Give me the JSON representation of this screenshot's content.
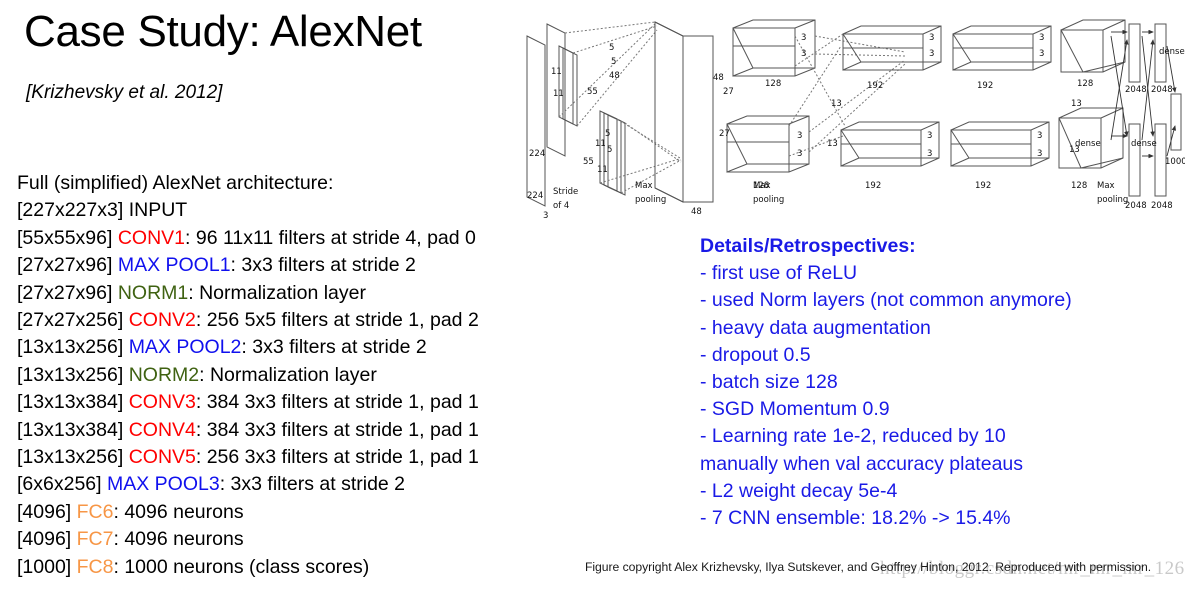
{
  "slide": {
    "title": "Case Study: AlexNet",
    "citation": "[Krizhevsky et al. 2012]"
  },
  "architecture": {
    "heading": "Full (simplified) AlexNet architecture:",
    "lines": [
      {
        "dims": "[227x227x3]",
        "layer": "INPUT",
        "layer_color": "plain",
        "desc": ""
      },
      {
        "dims": "[55x55x96]",
        "layer": "CONV1",
        "layer_color": "conv",
        "desc": ": 96 11x11 filters at stride 4, pad 0"
      },
      {
        "dims": "[27x27x96]",
        "layer": "MAX POOL1",
        "layer_color": "pool",
        "desc": ": 3x3 filters at stride 2"
      },
      {
        "dims": "[27x27x96]",
        "layer": "NORM1",
        "layer_color": "norm",
        "desc": ": Normalization layer"
      },
      {
        "dims": "[27x27x256]",
        "layer": "CONV2",
        "layer_color": "conv",
        "desc": ": 256 5x5 filters at stride 1, pad 2"
      },
      {
        "dims": "[13x13x256]",
        "layer": "MAX POOL2",
        "layer_color": "pool",
        "desc": ": 3x3 filters at stride 2"
      },
      {
        "dims": "[13x13x256]",
        "layer": "NORM2",
        "layer_color": "norm",
        "desc": ": Normalization layer"
      },
      {
        "dims": "[13x13x384]",
        "layer": "CONV3",
        "layer_color": "conv",
        "desc": ": 384 3x3 filters at stride 1, pad 1"
      },
      {
        "dims": "[13x13x384]",
        "layer": "CONV4",
        "layer_color": "conv",
        "desc": ": 384 3x3 filters at stride 1, pad 1"
      },
      {
        "dims": "[13x13x256]",
        "layer": "CONV5",
        "layer_color": "conv",
        "desc": ": 256 3x3 filters at stride 1, pad 1"
      },
      {
        "dims": "[6x6x256]",
        "layer": "MAX POOL3",
        "layer_color": "pool",
        "desc": ": 3x3 filters at stride 2"
      },
      {
        "dims": "[4096]",
        "layer": "FC6",
        "layer_color": "fc",
        "desc": ": 4096 neurons"
      },
      {
        "dims": "[4096]",
        "layer": "FC7",
        "layer_color": "fc",
        "desc": ": 4096 neurons"
      },
      {
        "dims": "[1000]",
        "layer": "FC8",
        "layer_color": "fc",
        "desc": ": 1000 neurons (class scores)"
      }
    ]
  },
  "details": {
    "heading": "Details/Retrospectives:",
    "bullets": [
      "- first use of ReLU",
      "- used Norm layers (not common anymore)",
      "- heavy data augmentation",
      "- dropout 0.5",
      "- batch size 128",
      "- SGD Momentum 0.9",
      "- Learning rate 1e-2, reduced by 10",
      "manually when val accuracy plateaus",
      "- L2 weight decay 5e-4",
      "- 7 CNN ensemble: 18.2% -> 15.4%"
    ]
  },
  "figure": {
    "caption": "Figure copyright Alex Krizhevsky, Ilya Sutskever, and Geoffrey Hinton, 2012. Reproduced with permission.",
    "watermark": "http://bloggr.csdn.net/mr_mr_mr_126",
    "labels": {
      "input_h": "224",
      "input_w": "224",
      "input_depth": "3",
      "filter11_a": "11",
      "filter11_b": "11",
      "filter11_c": "11",
      "filter11_d": "11",
      "stride_of_4": "Stride\nof 4",
      "stride_line1": "Stride",
      "stride_line2": "of 4",
      "conv1_size_top": "55",
      "conv1_size_bottom": "55",
      "conv1_depth_top": "48",
      "conv1_depth_bottom": "48",
      "k5_a": "5",
      "k5_b": "5",
      "k5_c": "5",
      "k5_d": "5",
      "conv2_size_top": "27",
      "conv2_size_bottom": "27",
      "conv2_depth_top": "128",
      "conv2_depth_bottom": "128",
      "k3_list": "3",
      "conv3_size": "13",
      "conv3_depth_top": "192",
      "conv3_depth_bottom": "192",
      "conv4_depth_top": "192",
      "conv4_depth_bottom": "192",
      "conv5_depth_top": "128",
      "conv5_depth_bottom": "128",
      "fc_2048_a": "2048",
      "fc_2048_b": "2048",
      "fc_2048_c": "2048",
      "fc_2048_d": "2048",
      "output_1000": "1000",
      "dense_a": "dense",
      "dense_b": "dense",
      "dense_c": "dense",
      "maxpool_1": "Max\npooling",
      "maxpool_2": "Max\npooling",
      "maxpool_3": "Max\npooling",
      "maxpool_line1": "Max",
      "maxpool_line2": "pooling"
    }
  },
  "colors": {
    "conv": "#ff0000",
    "pool": "#1010ee",
    "norm": "#3f6212",
    "fc": "#f79646",
    "details_blue": "#1a1ae6"
  }
}
